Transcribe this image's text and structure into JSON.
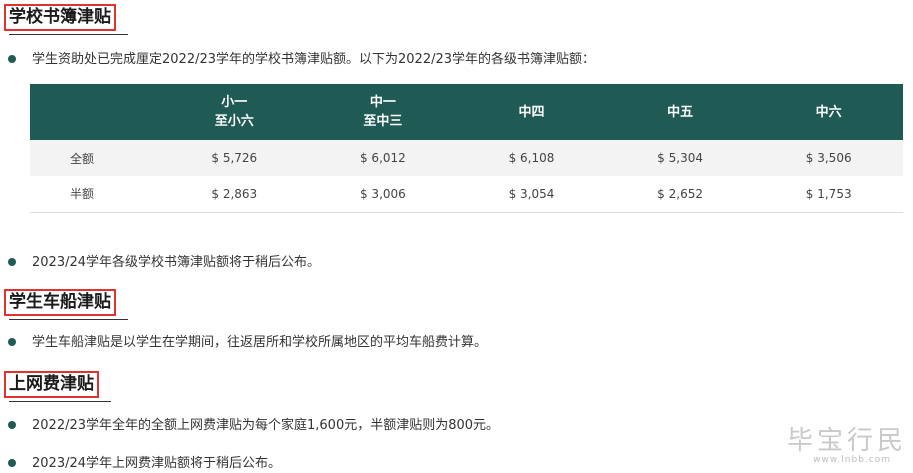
{
  "sections": {
    "textbook": {
      "title": "学校书簿津贴",
      "intro": "学生资助处已完成厘定2022/23学年的学校书簿津贴额。以下为2022/23学年的各级书簿津贴额：",
      "note": "2023/24学年各级学校书簿津贴额将于稍后公布。"
    },
    "travel": {
      "title": "学生车船津贴",
      "text": "学生车船津贴是以学生在学期间，往返居所和学校所属地区的平均车船费计算。"
    },
    "internet": {
      "title": "上网费津贴",
      "text1": "2022/23学年全年的全额上网费津贴为每个家庭1,600元，半额津贴则为800元。",
      "text2": "2023/24学年上网费津贴额将于稍后公布。"
    }
  },
  "table": {
    "headers": [
      {
        "line1": "",
        "line2": ""
      },
      {
        "line1": "小一",
        "line2": "至小六"
      },
      {
        "line1": "中一",
        "line2": "至中三"
      },
      {
        "line1": "中四",
        "line2": ""
      },
      {
        "line1": "中五",
        "line2": ""
      },
      {
        "line1": "中六",
        "line2": ""
      }
    ],
    "rows": [
      {
        "label": "全额",
        "cells": [
          "$ 5,726",
          "$ 6,012",
          "$ 6,108",
          "$ 5,304",
          "$ 3,506"
        ]
      },
      {
        "label": "半额",
        "cells": [
          "$ 2,863",
          "$ 3,006",
          "$ 3,054",
          "$ 2,652",
          "$ 1,753"
        ]
      }
    ]
  },
  "watermark": {
    "text": "毕宝行民",
    "sub": "www.lnbb.com"
  },
  "colors": {
    "header_bg": "#1f5a55",
    "bullet": "#1f5a55",
    "title_border": "#e0322f"
  }
}
